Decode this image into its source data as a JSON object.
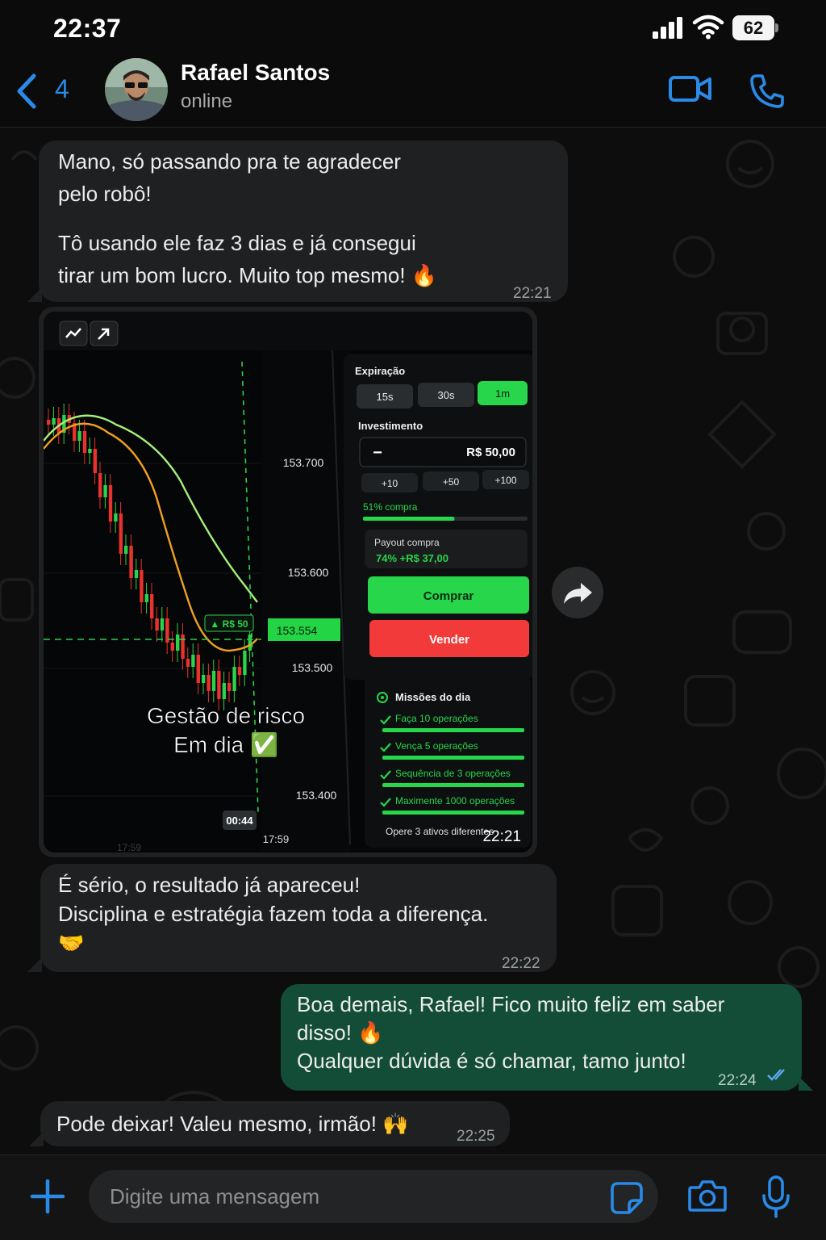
{
  "status_bar": {
    "time": "22:37",
    "battery": "62"
  },
  "header": {
    "back_count": "4",
    "contact_name": "Rafael Santos",
    "contact_status": "online"
  },
  "messages": [
    {
      "dir": "in",
      "lines": [
        "Mano, só passando pra te agradecer",
        "pelo robô!"
      ],
      "lines2": [
        "Tô usando ele faz 3 dias e já consegui",
        "tirar um bom lucro. Muito top mesmo! 🔥"
      ],
      "time": "22:21"
    },
    {
      "dir": "in",
      "type": "image",
      "time": "22:21"
    },
    {
      "dir": "in",
      "lines": [
        "É sério, o resultado já apareceu!",
        "Disciplina e estratégia fazem toda a diferença.",
        "🤝"
      ],
      "time": "22:22"
    },
    {
      "dir": "out",
      "lines": [
        "Boa demais, Rafael! Fico muito feliz em saber",
        "disso! 🔥",
        "Qualquer dúvida é só chamar, tamo junto!"
      ],
      "time": "22:24",
      "read": true
    },
    {
      "dir": "in",
      "lines": [
        "Pode deixar! Valeu mesmo, irmão! 🙌"
      ],
      "time": "22:25"
    }
  ],
  "screenshot": {
    "prices": [
      "153.700",
      "153.600",
      "153.554",
      "153.500",
      "153.400"
    ],
    "marker": "▲ R$ 50",
    "timer": "00:44",
    "time_left": "17:59",
    "time_left_faint": "17:59",
    "overlay_line1": "Gestão de risco",
    "overlay_line2": "Em dia ✅",
    "panel": {
      "expiracao_label": "Expiração",
      "expiracao_options": [
        "15s",
        "30s",
        "1m"
      ],
      "investimento_label": "Investimento",
      "minus": "−",
      "amount": "R$ 50,00",
      "quick_adds": [
        "+10",
        "+50",
        "+100"
      ],
      "compra_pct": "51% compra",
      "compra_fraction": 0.51,
      "payout_label": "Payout compra",
      "payout_value": "74%  +R$ 37,00",
      "buy_label": "Comprar",
      "sell_label": "Vender",
      "missions_title": "Missões do dia",
      "missions": [
        "Faça 10 operações",
        "Vença 5 operações",
        "Sequência de 3 operações",
        "Maximente 1000 operações"
      ],
      "missions_footer": "Opere 3 ativos diferentes"
    }
  },
  "composer": {
    "placeholder": "Digite uma mensagem"
  },
  "colors": {
    "accent": "#2a8ae8",
    "outgoing": "#134d37",
    "incoming": "#1f2021",
    "buy": "#27d64a",
    "sell": "#f23a3a"
  }
}
